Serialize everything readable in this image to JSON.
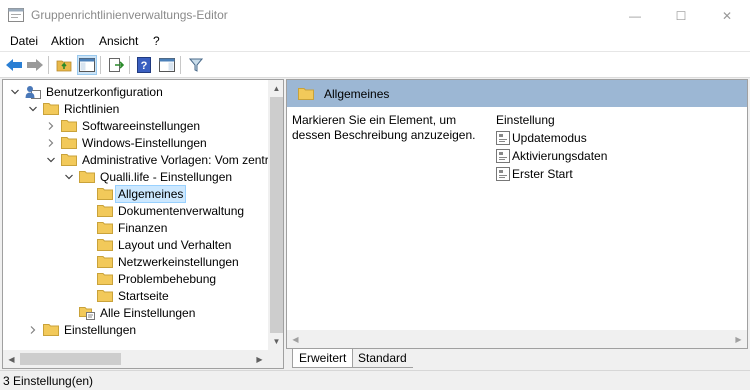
{
  "window": {
    "title": "Gruppenrichtlinienverwaltungs-Editor",
    "minimize_glyph": "—",
    "maximize_glyph": "☐",
    "close_glyph": "✕"
  },
  "menu": [
    "Datei",
    "Aktion",
    "Ansicht",
    "?"
  ],
  "toolbar": {
    "buttons": [
      "back-icon",
      "forward-icon",
      "up-folder-icon",
      "show-hide-tree-icon",
      "export-list-icon",
      "help-icon",
      "properties-view-icon",
      "filter-icon"
    ],
    "pressed": "show-hide-tree-icon"
  },
  "tree": {
    "items": [
      {
        "label": "Benutzerkonfiguration",
        "level": 0,
        "expanded": true,
        "icon": "user-config-icon"
      },
      {
        "label": "Richtlinien",
        "level": 1,
        "expanded": true,
        "icon": "folder-icon"
      },
      {
        "label": "Softwareeinstellungen",
        "level": 2,
        "expanded": false,
        "icon": "folder-icon"
      },
      {
        "label": "Windows-Einstellungen",
        "level": 2,
        "expanded": false,
        "icon": "folder-icon"
      },
      {
        "label": "Administrative Vorlagen: Vom zentral",
        "level": 2,
        "expanded": true,
        "icon": "folder-icon"
      },
      {
        "label": "Qualli.life - Einstellungen",
        "level": 3,
        "expanded": true,
        "icon": "folder-icon"
      },
      {
        "label": "Allgemeines",
        "level": 4,
        "selected": true,
        "icon": "folder-icon"
      },
      {
        "label": "Dokumentenverwaltung",
        "level": 4,
        "icon": "folder-icon"
      },
      {
        "label": "Finanzen",
        "level": 4,
        "icon": "folder-icon"
      },
      {
        "label": "Layout und Verhalten",
        "level": 4,
        "icon": "folder-icon"
      },
      {
        "label": "Netzwerkeinstellungen",
        "level": 4,
        "icon": "folder-icon"
      },
      {
        "label": "Problembehebung",
        "level": 4,
        "icon": "folder-icon"
      },
      {
        "label": "Startseite",
        "level": 4,
        "icon": "folder-icon"
      },
      {
        "label": "Alle Einstellungen",
        "level": 3,
        "icon": "all-settings-icon"
      },
      {
        "label": "Einstellungen",
        "level": 1,
        "expanded": false,
        "icon": "folder-icon"
      }
    ]
  },
  "details": {
    "header": "Allgemeines",
    "description": "Markieren Sie ein Element, um dessen Beschreibung anzuzeigen.",
    "column_header": "Einstellung",
    "items": [
      "Updatemodus",
      "Aktivierungsdaten",
      "Erster Start"
    ]
  },
  "tabs": [
    "Erweitert",
    "Standard"
  ],
  "status": "3 Einstellung(en)",
  "colors": {
    "selection": "#cce8ff",
    "header_band": "#9cb7d4",
    "folder": "#f2c95a"
  }
}
